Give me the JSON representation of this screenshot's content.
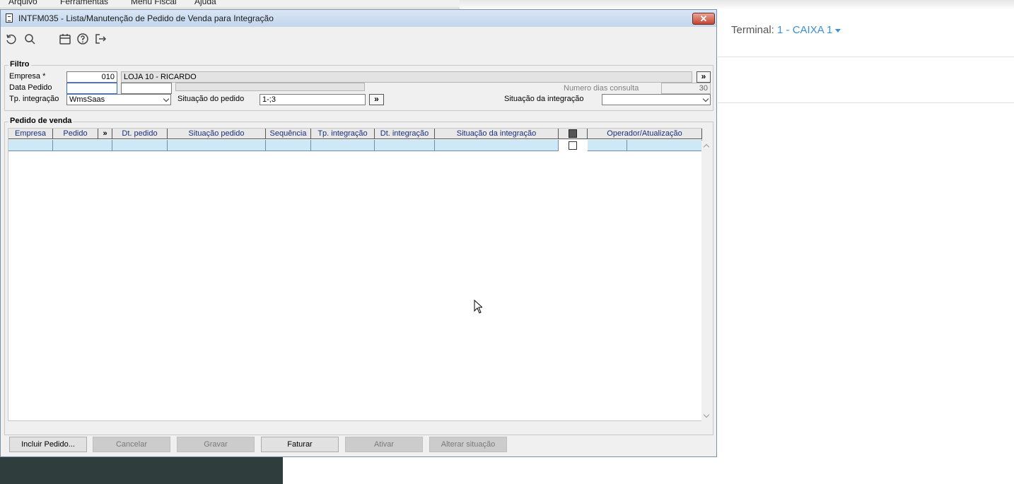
{
  "background": {
    "menu": [
      "Arquivo",
      "Ferramentas",
      "Menu Fiscal",
      "Ajuda"
    ],
    "terminal_label": "Terminal:",
    "terminal_value": "1 - CAIXA 1"
  },
  "window": {
    "title": "INTFM035 - Lista/Manutenção de Pedido de Venda para Integração",
    "toolbar_icons": [
      "undo-icon",
      "search-icon",
      "calendar-icon",
      "help-icon",
      "exit-icon"
    ]
  },
  "filtro": {
    "title": "Filtro",
    "empresa_label": "Empresa *",
    "empresa_code": "010",
    "empresa_name": "LOJA 10 - RICARDO",
    "more_button": "»",
    "data_pedido_label": "Data Pedido",
    "data_pedido_from": "",
    "data_pedido_to": "",
    "numero_dias_label": "Numero dias consulta",
    "numero_dias_value": "30",
    "tp_integracao_label": "Tp. integração",
    "tp_integracao_value": "WmsSaas",
    "situacao_pedido_label": "Situação do pedido",
    "situacao_pedido_value": "1-;3",
    "situacao_integracao_label": "Situação da integração",
    "situacao_integracao_value": ""
  },
  "pedido": {
    "title": "Pedido de venda",
    "columns": [
      "Empresa",
      "Pedido",
      "»",
      "Dt. pedido",
      "Situação pedido",
      "Sequência",
      "Tp. integração",
      "Dt. integração",
      "Situação da integração",
      "",
      "Operador/Atualização"
    ]
  },
  "buttons": {
    "incluir": "Incluir Pedido...",
    "cancelar": "Cancelar",
    "gravar": "Gravar",
    "faturar": "Faturar",
    "ativar": "Ativar",
    "alterar": "Alterar situação"
  }
}
